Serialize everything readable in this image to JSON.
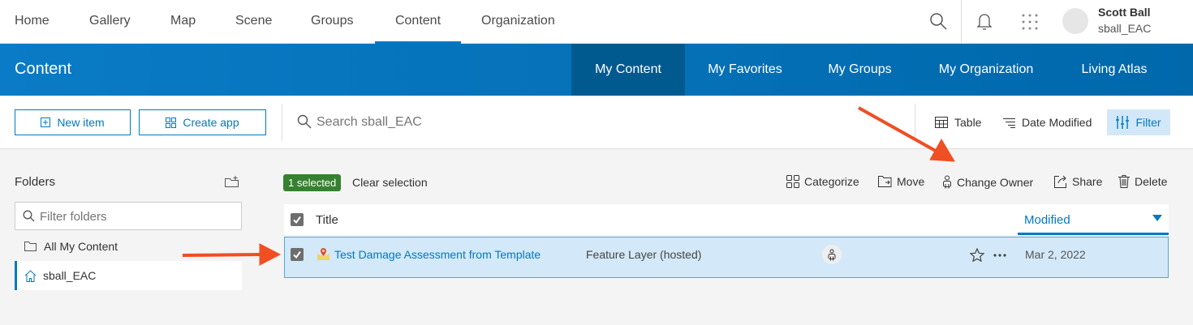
{
  "topnav": {
    "items": [
      "Home",
      "Gallery",
      "Map",
      "Scene",
      "Groups",
      "Content",
      "Organization"
    ],
    "active": "Content",
    "user": {
      "name": "Scott Ball",
      "username": "sball_EAC"
    }
  },
  "header": {
    "title": "Content",
    "tabs": [
      "My Content",
      "My Favorites",
      "My Groups",
      "My Organization",
      "Living Atlas"
    ],
    "active": "My Content"
  },
  "toolbar": {
    "new_item": "New item",
    "create_app": "Create app",
    "search_placeholder": "Search sball_EAC",
    "table": "Table",
    "sort": "Date Modified",
    "filter": "Filter"
  },
  "folders": {
    "title": "Folders",
    "filter_placeholder": "Filter folders",
    "items": [
      "All My Content",
      "sball_EAC"
    ],
    "active": "sball_EAC"
  },
  "selection": {
    "badge": "1 selected",
    "clear": "Clear selection",
    "actions": [
      "Categorize",
      "Move",
      "Change Owner",
      "Share",
      "Delete"
    ]
  },
  "table": {
    "col_title": "Title",
    "col_modified": "Modified",
    "rows": [
      {
        "title": "Test Damage Assessment from Template",
        "type": "Feature Layer (hosted)",
        "modified": "Mar 2, 2022",
        "selected": true
      }
    ]
  },
  "colors": {
    "accent": "#0079c1",
    "blue_bar": "#0a7bc6",
    "selected_badge": "#35812f",
    "row_selected": "#d3e9f9",
    "arrow": "#f04e23"
  }
}
